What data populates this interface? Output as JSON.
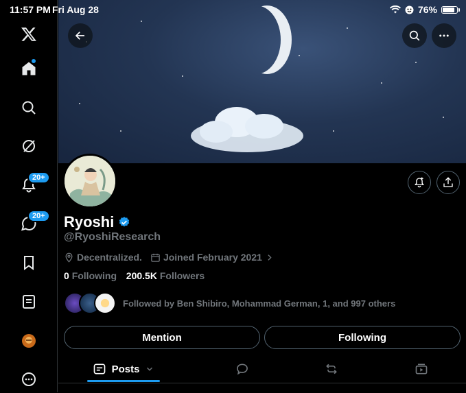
{
  "status_bar": {
    "time": "11:57 PM",
    "date": "Fri Aug 28",
    "battery": "76%",
    "battery_level": 0.76
  },
  "sidebar": {
    "items": [
      {
        "name": "x-logo"
      },
      {
        "name": "home-icon"
      },
      {
        "name": "search-icon"
      },
      {
        "name": "grok-icon"
      },
      {
        "name": "notifications-icon",
        "badge": "20+"
      },
      {
        "name": "messages-icon",
        "badge": "20+"
      },
      {
        "name": "bookmarks-icon"
      },
      {
        "name": "lists-icon"
      },
      {
        "name": "account-avatar"
      },
      {
        "name": "more-icon"
      }
    ]
  },
  "profile": {
    "name": "Ryoshi",
    "handle": "@RyoshiResearch",
    "location": "Decentralized.",
    "joined": "Joined February 2021",
    "following_count": "0",
    "following_label": "Following",
    "followers_count": "200.5K",
    "followers_label": "Followers",
    "followed_by": "Followed by Ben Shibiro, Mohammad German, 1, and 997 others"
  },
  "actions": {
    "mention": "Mention",
    "following": "Following"
  },
  "tabs": [
    {
      "label": "Posts",
      "icon": "posts-icon"
    },
    {
      "label": "",
      "icon": "replies-icon"
    },
    {
      "label": "",
      "icon": "reposts-icon"
    },
    {
      "label": "",
      "icon": "media-icon"
    }
  ],
  "colors": {
    "accent": "#1d9bf0",
    "background": "#000000",
    "muted": "#71767b"
  }
}
